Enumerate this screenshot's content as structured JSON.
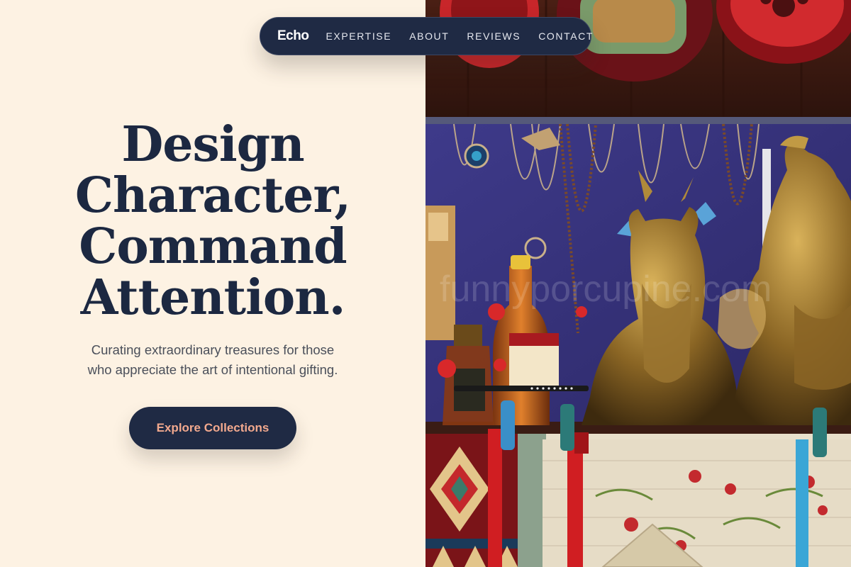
{
  "nav": {
    "brand": "Echo",
    "links": [
      "EXPERTISE",
      "ABOUT",
      "REVIEWS",
      "CONTACT"
    ]
  },
  "hero": {
    "headline_lines": [
      "Design",
      "Character,",
      "Command",
      "Attention."
    ],
    "subline_lines": [
      "Curating extraordinary treasures for those",
      "who appreciate the art of intentional gifting."
    ],
    "cta_label": "Explore Collections"
  },
  "photo": {
    "subject": "souvenir market stall: carved wooden plates, hanging necklaces, bronze bust figurines, brandy bottles, embroidered textiles",
    "watermark": "funnyporcupine.com"
  },
  "colors": {
    "background": "#fdf2e3",
    "navy": "#1f2a44",
    "cta_text": "#f2a98e",
    "body_text": "#4a4f5a"
  }
}
